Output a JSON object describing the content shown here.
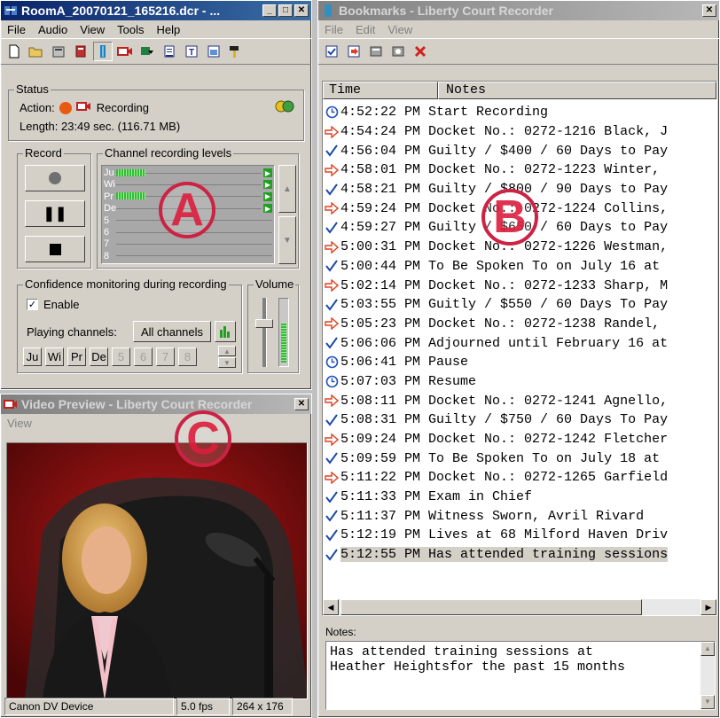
{
  "recorder": {
    "title": "RoomA_20070121_165216.dcr - ...",
    "menu": [
      "File",
      "Audio",
      "View",
      "Tools",
      "Help"
    ],
    "toolbar_icons": [
      "new-icon",
      "open-icon",
      "properties-icon",
      "book-icon",
      "bookmark-icon",
      "record-camera-icon",
      "export-icon",
      "list-icon",
      "text-icon",
      "window-icon",
      "hammer-icon"
    ],
    "status": {
      "label": "Status",
      "action_label": "Action:",
      "action_value": "Recording",
      "length": "Length: 23:49 sec. (116.71 MB)"
    },
    "record": {
      "label": "Record"
    },
    "channels": {
      "label": "Channel recording levels",
      "names": [
        "Ju",
        "Wi",
        "Pr",
        "De",
        "5",
        "6",
        "7",
        "8"
      ],
      "levels": [
        0.55,
        0.0,
        0.55,
        0.0,
        0,
        0,
        0,
        0
      ]
    },
    "confidence": {
      "label": "Confidence monitoring during recording",
      "enable_label": "Enable",
      "enabled": true,
      "playing_label": "Playing channels:",
      "all_channels_label": "All channels",
      "channel_buttons": [
        "Ju",
        "Wi",
        "Pr",
        "De",
        "5",
        "6",
        "7",
        "8"
      ]
    },
    "volume": {
      "label": "Volume",
      "level": 0.65
    }
  },
  "preview": {
    "title": "Video Preview - Liberty Court Recorder",
    "menu": [
      "View"
    ],
    "status": {
      "device": "Canon DV Device",
      "fps": "5.0 fps",
      "size": "264 x 176"
    }
  },
  "bookmarks": {
    "title": "Bookmarks - Liberty Court Recorder",
    "menu": [
      "File",
      "Edit",
      "View"
    ],
    "columns": [
      "Time",
      "Notes"
    ],
    "rows": [
      {
        "icon": "clock",
        "time": "4:52:22 PM",
        "note": "Start Recording"
      },
      {
        "icon": "arrow",
        "time": "4:54:24 PM",
        "note": "Docket No.: 0272-1216 Black, J"
      },
      {
        "icon": "check",
        "time": "4:56:04 PM",
        "note": "Guilty / $400 / 60 Days to Pay"
      },
      {
        "icon": "arrow",
        "time": "4:58:01 PM",
        "note": "Docket No.: 0272-1223 Winter,"
      },
      {
        "icon": "check",
        "time": "4:58:21 PM",
        "note": "Guilty / $800 / 90 Days to Pay"
      },
      {
        "icon": "arrow",
        "time": "4:59:24 PM",
        "note": "Docket No.: 0272-1224 Collins,"
      },
      {
        "icon": "check",
        "time": "4:59:27 PM",
        "note": "Guilty / $650 / 60 Days to Pay"
      },
      {
        "icon": "arrow",
        "time": "5:00:31 PM",
        "note": "Docket No.: 0272-1226 Westman,"
      },
      {
        "icon": "check",
        "time": "5:00:44 PM",
        "note": "To Be Spoken To on July 16 at"
      },
      {
        "icon": "arrow",
        "time": "5:02:14 PM",
        "note": "Docket No.: 0272-1233 Sharp, M"
      },
      {
        "icon": "check",
        "time": "5:03:55 PM",
        "note": "Guitly / $550 / 60 Days To Pay"
      },
      {
        "icon": "arrow",
        "time": "5:05:23 PM",
        "note": "Docket No.: 0272-1238 Randel,"
      },
      {
        "icon": "check",
        "time": "5:06:06 PM",
        "note": "Adjourned until February 16 at"
      },
      {
        "icon": "clock",
        "time": "5:06:41 PM",
        "note": "Pause"
      },
      {
        "icon": "clock",
        "time": "5:07:03 PM",
        "note": "Resume"
      },
      {
        "icon": "arrow",
        "time": "5:08:11 PM",
        "note": "Docket No.: 0272-1241 Agnello,"
      },
      {
        "icon": "check",
        "time": "5:08:31 PM",
        "note": "Guilty / $750 / 60 Days To Pay"
      },
      {
        "icon": "arrow",
        "time": "5:09:24 PM",
        "note": "Docket No.: 0272-1242 Fletcher"
      },
      {
        "icon": "check",
        "time": "5:09:59 PM",
        "note": "To Be Spoken To on July 18 at"
      },
      {
        "icon": "arrow",
        "time": "5:11:22 PM",
        "note": "Docket No.: 0272-1265 Garfield"
      },
      {
        "icon": "check",
        "time": "5:11:33 PM",
        "note": "Exam in Chief"
      },
      {
        "icon": "check",
        "time": "5:11:37 PM",
        "note": "Witness Sworn, Avril Rivard"
      },
      {
        "icon": "check",
        "time": "5:12:19 PM",
        "note": "Lives at 68 Milford Haven Driv"
      },
      {
        "icon": "check",
        "time": "5:12:55 PM",
        "note": "Has attended training sessions",
        "selected": true
      }
    ],
    "notes_label": "Notes:",
    "notes_text": "Has attended training sessions at\nHeather Heightsfor the past 15 months"
  },
  "callouts": [
    "A",
    "B",
    "C"
  ],
  "colors": {
    "title_active": "#0a246a",
    "record_orange": "#e85a10",
    "check_blue": "#1a4aa8",
    "arrow_red": "#e04020",
    "clock_blue": "#2050c0",
    "callout_red": "#cc2244"
  }
}
